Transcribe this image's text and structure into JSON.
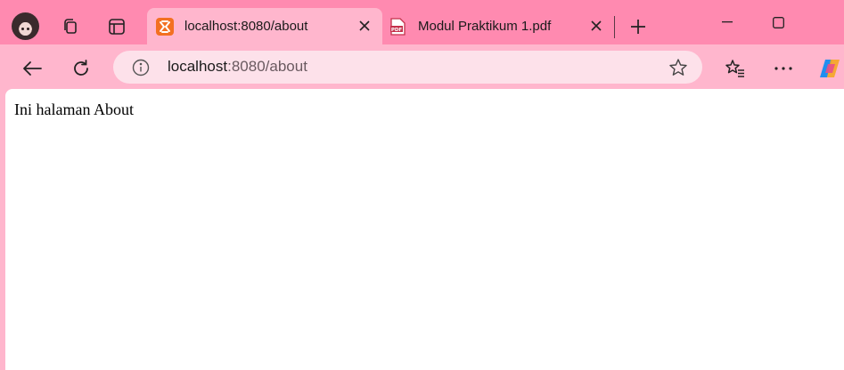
{
  "browser": {
    "tabs": [
      {
        "title": "localhost:8080/about",
        "icon": "xampp-icon",
        "active": true
      },
      {
        "title": "Modul Praktikum 1.pdf",
        "icon": "pdf-icon",
        "active": false
      }
    ],
    "new_tab_icon": "plus-icon",
    "window_controls": [
      "minimize-icon",
      "maximize-icon"
    ],
    "address": {
      "host": "localhost",
      "rest": ":8080/about"
    },
    "colors": {
      "tabstrip": "#ff8ab0",
      "toolbar": "#ffb6cd",
      "omnibox": "#fde1ea"
    }
  },
  "page": {
    "text": "Ini halaman About"
  }
}
